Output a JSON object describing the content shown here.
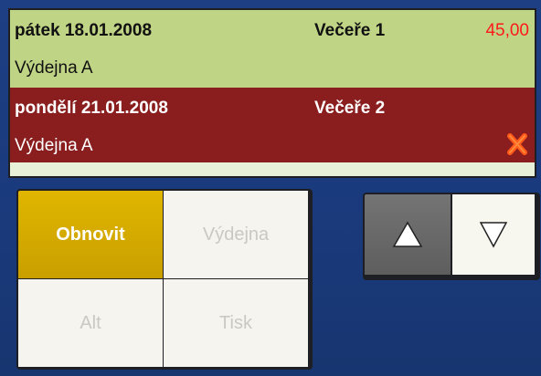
{
  "orders": [
    {
      "date": "pátek 18.01.2008",
      "meal": "Večeře 1",
      "price": "45,00",
      "place": "Výdejna A",
      "row_color": "#bfd485"
    },
    {
      "date": "pondělí 21.01.2008",
      "meal": "Večeře 2",
      "place": "Výdejna A",
      "row_color": "#8a1e1e",
      "icon": "cancel-x-icon"
    }
  ],
  "buttons": {
    "refresh": "Obnovit",
    "dispensary": "Výdejna",
    "alt": "Alt",
    "print": "Tisk"
  },
  "colors": {
    "accent": "#e0b600",
    "background": "#1a3a7d",
    "price": "#ff1a1a"
  },
  "icons": {
    "scroll_up": "triangle-up-icon",
    "scroll_down": "triangle-down-icon"
  }
}
